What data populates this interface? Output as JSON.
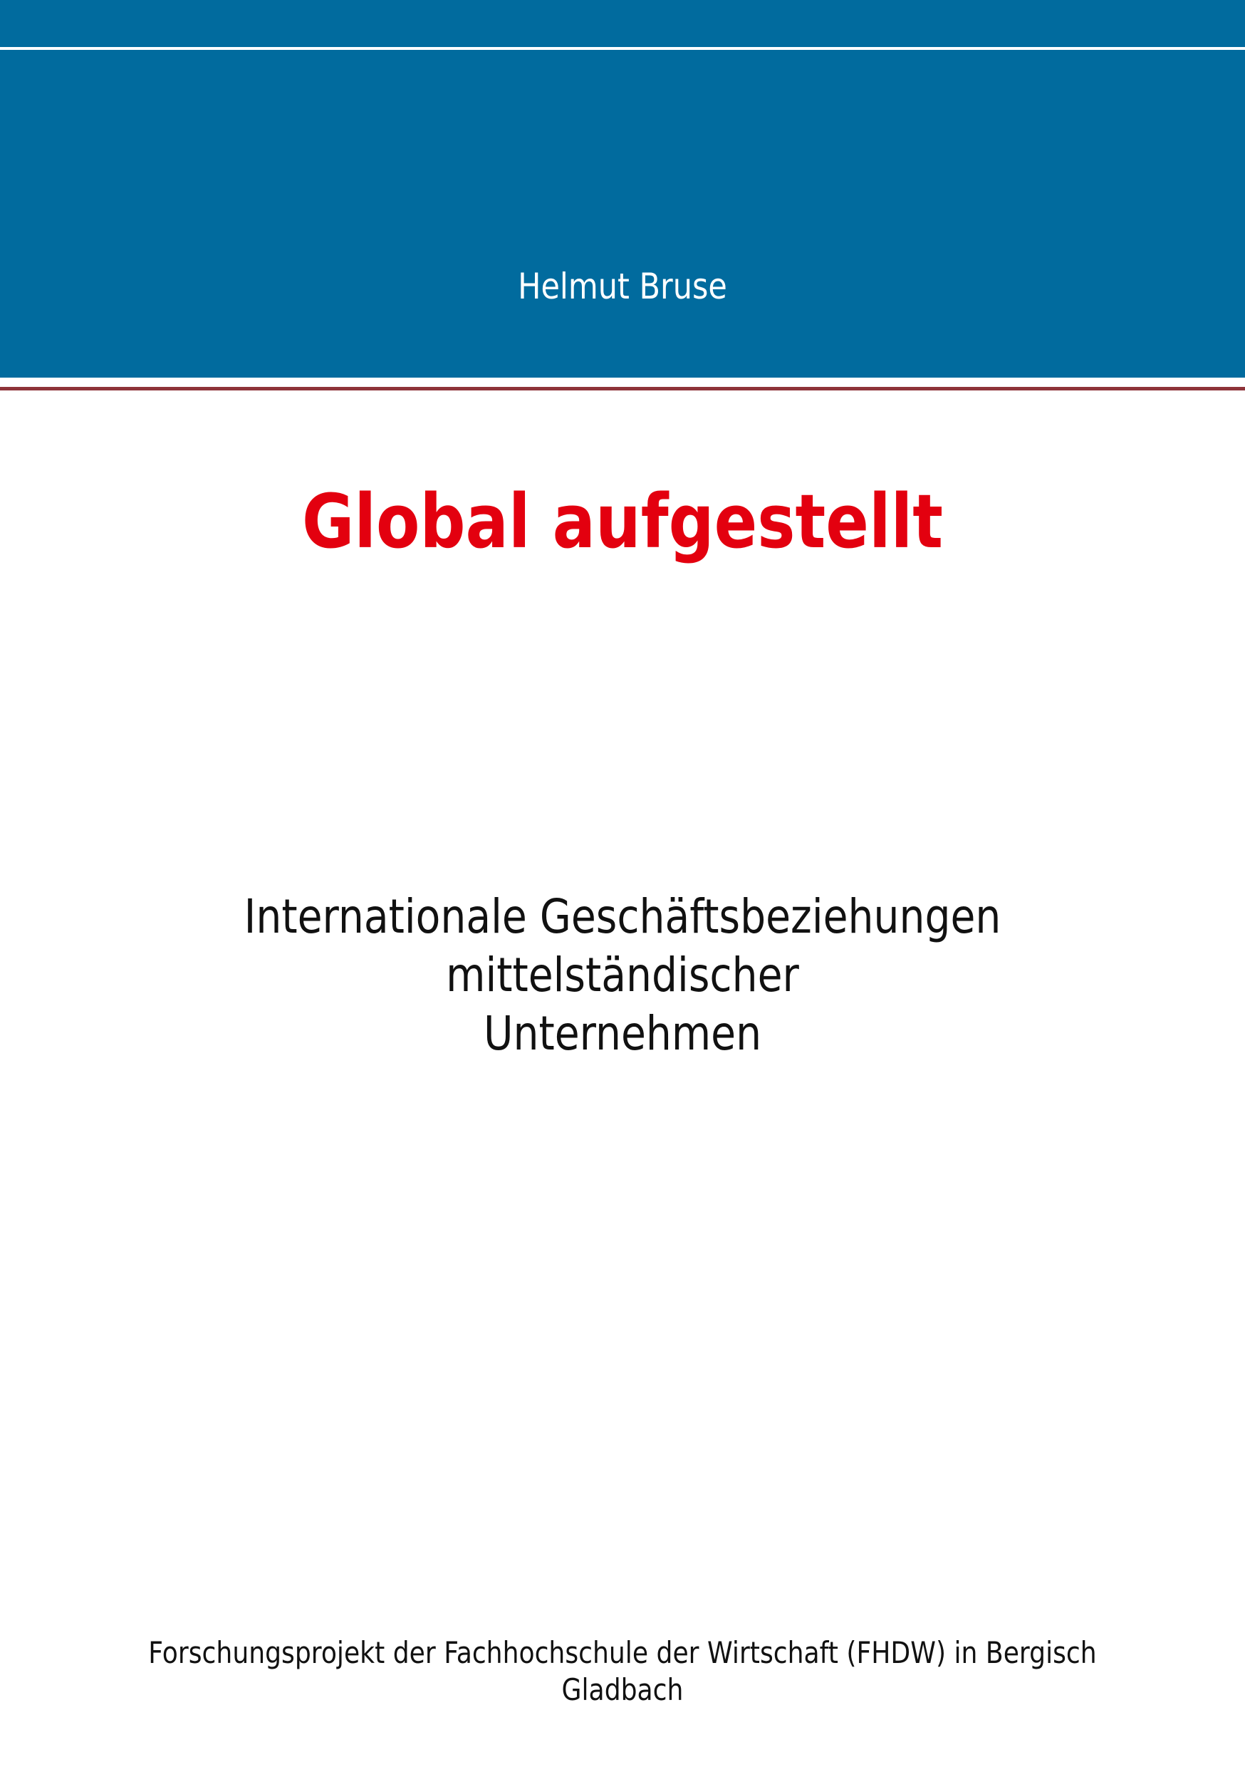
{
  "cover": {
    "author": "Helmut Bruse",
    "title": "Global aufgestellt",
    "subtitle_line1": "Internationale Geschäftsbeziehungen mittelständischer",
    "subtitle_line2": "Unternehmen",
    "footer": "Forschungsprojekt der Fachhochschule der Wirtschaft (FHDW) in Bergisch Gladbach"
  },
  "colors": {
    "band": "#016b9e",
    "title": "#e3000f",
    "divider": "#8e3339",
    "text": "#111111"
  }
}
